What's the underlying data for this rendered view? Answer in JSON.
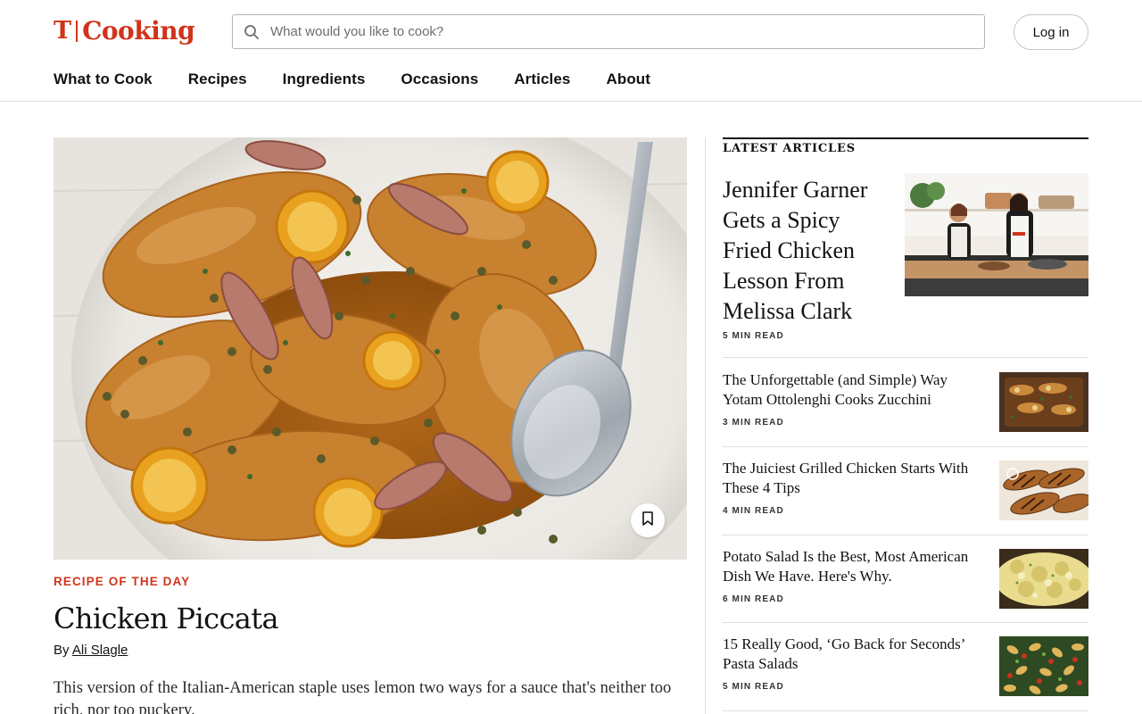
{
  "header": {
    "logo_mark": "T",
    "logo_word": "Cooking",
    "search_placeholder": "What would you like to cook?",
    "login_label": "Log in"
  },
  "nav": {
    "items": [
      "What to Cook",
      "Recipes",
      "Ingredients",
      "Occasions",
      "Articles",
      "About"
    ]
  },
  "hero": {
    "kicker": "RECIPE OF THE DAY",
    "title": "Chicken Piccata",
    "by_prefix": "By ",
    "author": "Ali Slagle",
    "description": "This version of the Italian-American staple uses lemon two ways for a sauce that's neither too rich, nor too puckery."
  },
  "sidebar": {
    "heading": "LATEST ARTICLES",
    "featured": {
      "title": "Jennifer Garner Gets a Spicy Fried Chicken Lesson From Melissa Clark",
      "meta": "5 MIN READ"
    },
    "articles": [
      {
        "title": "The Unforgettable (and Simple) Way Yotam Ottolenghi Cooks Zucchini",
        "meta": "3 MIN READ"
      },
      {
        "title": "The Juiciest Grilled Chicken Starts With These 4 Tips",
        "meta": "4 MIN READ"
      },
      {
        "title": "Potato Salad Is the Best, Most American Dish We Have. Here's Why.",
        "meta": "6 MIN READ"
      },
      {
        "title": "15 Really Good, ‘Go Back for Seconds’ Pasta Salads",
        "meta": "5 MIN READ"
      }
    ]
  },
  "colors": {
    "brand_red": "#d0341a",
    "text": "#121212",
    "rule": "#dfdfdf"
  },
  "icons": {
    "search": "search-icon",
    "bookmark": "bookmark-icon"
  }
}
